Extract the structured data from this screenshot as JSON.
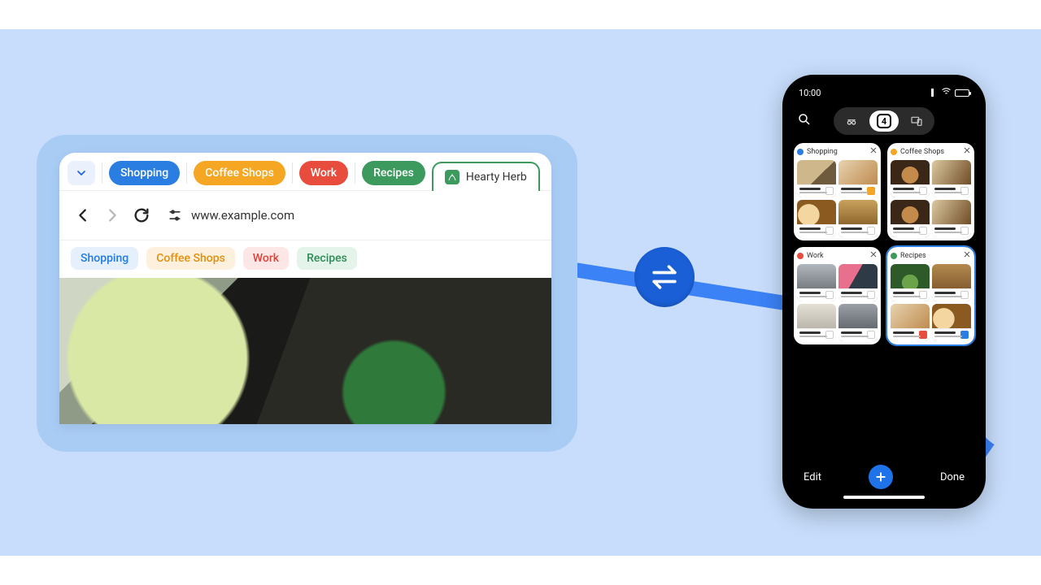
{
  "desktop": {
    "tab_pills": [
      {
        "label": "Shopping",
        "color": "c-blue"
      },
      {
        "label": "Coffee Shops",
        "color": "c-orange"
      },
      {
        "label": "Work",
        "color": "c-red"
      },
      {
        "label": "Recipes",
        "color": "c-green"
      }
    ],
    "active_tab_label": "Hearty Herb",
    "url": "www.example.com",
    "chips": [
      {
        "label": "Shopping",
        "style": "s-blue"
      },
      {
        "label": "Coffee Shops",
        "style": "s-orange"
      },
      {
        "label": "Work",
        "style": "s-red"
      },
      {
        "label": "Recipes",
        "style": "s-green"
      }
    ]
  },
  "phone": {
    "time": "10:00",
    "tab_count": "4",
    "groups": [
      {
        "label": "Shopping",
        "dot": "d-blue",
        "selected": false
      },
      {
        "label": "Coffee Shops",
        "dot": "d-orange",
        "selected": false
      },
      {
        "label": "Work",
        "dot": "d-red",
        "selected": false
      },
      {
        "label": "Recipes",
        "dot": "d-green",
        "selected": true
      }
    ],
    "edit_label": "Edit",
    "done_label": "Done"
  }
}
